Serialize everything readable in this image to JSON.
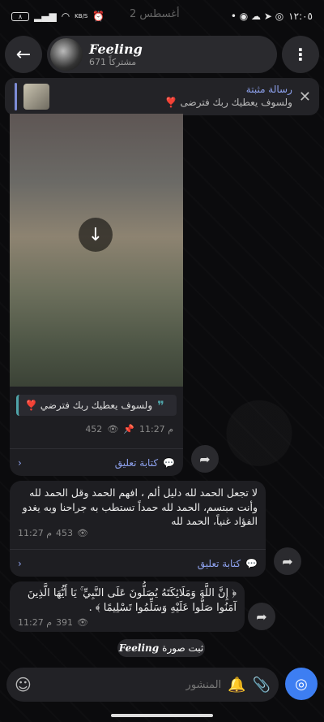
{
  "status": {
    "time": "١٢:٠٥",
    "battery": "٨",
    "speed": "KB/S",
    "date_hint": "2 أغسطس"
  },
  "header": {
    "channel_name": "Feeling",
    "subscribers": "671 مشتركاً"
  },
  "pinned": {
    "title": "رسالة مثبتة",
    "body": "ولسوف يعطيك ربك فترضى ❣️"
  },
  "post1": {
    "quote": "ولسوف يعطيك ربك فترضي ❣️",
    "time": "11:27 م",
    "views": "452",
    "comment_label": "كتابة تعليق"
  },
  "post2": {
    "text": "لا تجعل الحمد لله دليل ألم ، افهم الحمد وقل الحمد لله وأنت مبتسم، الحمد لله حمداً تستطب به جراحنا وبه يغدو الفؤاد غنياً، الحمد لله",
    "time": "11:27 م",
    "views": "453",
    "comment_label": "كتابة تعليق"
  },
  "post3": {
    "text": "﴿ إِنَّ اللَّهَ وَمَلَائِكَتَهُ يُصَلُّونَ عَلَى النَّبِيِّ ۚ يَا أَيُّهَا الَّذِينَ آمَنُوا صَلُّوا عَلَيْهِ وَسَلِّمُوا تَسْلِيمًا ﴾ .",
    "time": "11:27 م",
    "views": "391"
  },
  "service": {
    "actor": "Feeling",
    "action": "ثبت صورة"
  },
  "input": {
    "placeholder": "المنشور"
  }
}
